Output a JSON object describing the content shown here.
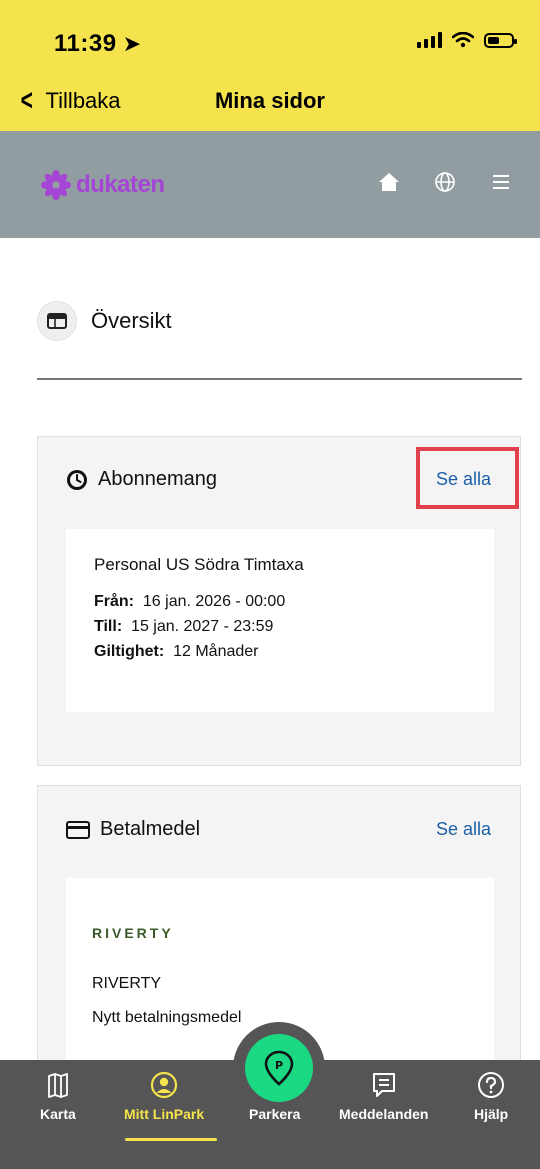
{
  "status": {
    "time": "11:39"
  },
  "nav": {
    "back_label": "Tillbaka",
    "title": "Mina sidor"
  },
  "brand": {
    "name": "dukaten",
    "color": "#a545d6",
    "icons": [
      "home-icon",
      "globe-icon",
      "menu-icon"
    ]
  },
  "overview": {
    "label": "Översikt"
  },
  "subscription": {
    "title": "Abonnemang",
    "see_all": "Se alla",
    "name": "Personal US Södra Timtaxa",
    "from_label": "Från:",
    "from_value": "16 jan. 2026 - 00:00",
    "to_label": "Till:",
    "to_value": "15 jan. 2027 - 23:59",
    "validity_label": "Giltighet:",
    "validity_value": "12 Månader"
  },
  "payment": {
    "title": "Betalmedel",
    "see_all": "Se alla",
    "logo_text": "RIVERTY",
    "name": "RIVERTY",
    "subtitle": "Nytt betalningsmedel"
  },
  "tabs": [
    {
      "label": "Karta",
      "icon": "map-icon"
    },
    {
      "label": "Mitt LinPark",
      "icon": "user-icon",
      "active": true
    },
    {
      "label": "Parkera",
      "icon": "parking-pin-icon"
    },
    {
      "label": "Meddelanden",
      "icon": "message-icon"
    },
    {
      "label": "Hjälp",
      "icon": "help-icon"
    }
  ],
  "colors": {
    "header_yellow": "#f4e34c",
    "brand_bar": "#929da1",
    "accent_green": "#1ad982",
    "link_blue": "#1d5fa8",
    "highlight_red": "#e0414d"
  }
}
